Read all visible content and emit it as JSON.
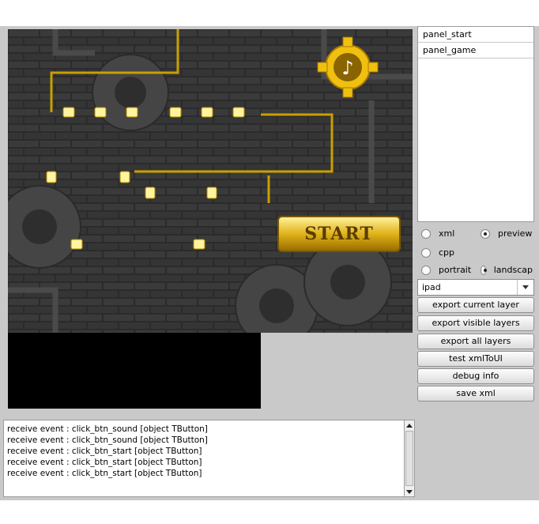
{
  "stage": {
    "start_label": "START",
    "sound_icon": "music-note-gear-icon"
  },
  "layers": [
    "panel_start",
    "panel_game"
  ],
  "options": {
    "format_xml": "xml",
    "format_preview": "preview",
    "cpp": "cpp",
    "portrait": "portrait",
    "landscape": "landscap",
    "selected_format": "preview",
    "selected_orientation": "landscape"
  },
  "device": {
    "selected": "ipad"
  },
  "buttons": {
    "export_current": "export current layer",
    "export_visible": "export visible layers",
    "export_all": "export all layers",
    "test_xml": "test xmlToUI",
    "debug_info": "debug info",
    "save_xml": "save xml"
  },
  "log": [
    "receive event : click_btn_sound [object TButton]",
    "receive event : click_btn_sound [object TButton]",
    "receive event : click_btn_start [object TButton]",
    "receive event : click_btn_start [object TButton]",
    "receive event : click_btn_start [object TButton]"
  ]
}
